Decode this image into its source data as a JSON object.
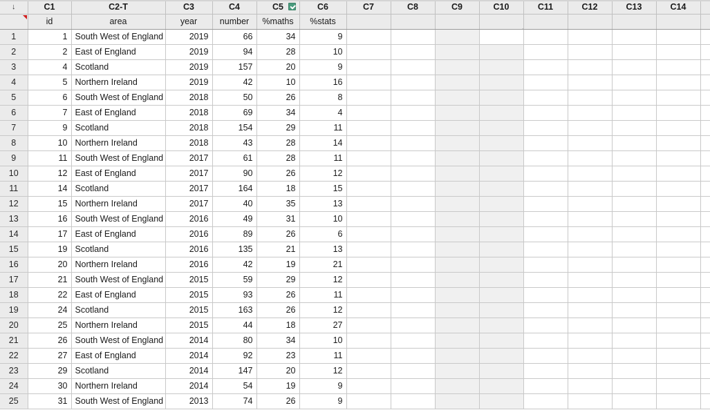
{
  "app": {
    "type": "minitab-worksheet",
    "corner_sort_icon": "down-arrow-icon",
    "row_header_marker": "red-triangle-marker"
  },
  "colors": {
    "header_bg": "#ebebeb",
    "grid_line": "#c8c8c8",
    "cell_bg": "#ffffff",
    "selection_bg": "#f0f0f0",
    "formula_badge": "#4a9c7e",
    "marker_red": "#d01f1f",
    "text": "#1a1a1a"
  },
  "columns": [
    {
      "id": "C1",
      "label": "C1",
      "name": "id",
      "type": "numeric",
      "align": "num",
      "width": 63,
      "badge": null
    },
    {
      "id": "C2",
      "label": "C2-T",
      "name": "area",
      "type": "text",
      "align": "txt",
      "width": 136,
      "badge": null
    },
    {
      "id": "C3",
      "label": "C3",
      "name": "year",
      "type": "numeric",
      "align": "num",
      "width": 68,
      "badge": null
    },
    {
      "id": "C4",
      "label": "C4",
      "name": "number",
      "type": "numeric",
      "align": "num",
      "width": 64,
      "badge": null
    },
    {
      "id": "C5",
      "label": "C5",
      "name": "%maths",
      "type": "numeric",
      "align": "num",
      "width": 62,
      "badge": "formula-badge-icon"
    },
    {
      "id": "C6",
      "label": "C6",
      "name": "%stats",
      "type": "numeric",
      "align": "num",
      "width": 68,
      "badge": null
    },
    {
      "id": "C7",
      "label": "C7",
      "name": "",
      "type": "empty",
      "align": "num",
      "width": 64,
      "badge": null
    },
    {
      "id": "C8",
      "label": "C8",
      "name": "",
      "type": "empty",
      "align": "num",
      "width": 64,
      "badge": null
    },
    {
      "id": "C9",
      "label": "C9",
      "name": "",
      "type": "empty",
      "align": "num",
      "width": 64,
      "badge": null
    },
    {
      "id": "C10",
      "label": "C10",
      "name": "",
      "type": "empty",
      "align": "num",
      "width": 64,
      "badge": null
    },
    {
      "id": "C11",
      "label": "C11",
      "name": "",
      "type": "empty",
      "align": "num",
      "width": 64,
      "badge": null
    },
    {
      "id": "C12",
      "label": "C12",
      "name": "",
      "type": "empty",
      "align": "num",
      "width": 64,
      "badge": null
    },
    {
      "id": "C13",
      "label": "C13",
      "name": "",
      "type": "empty",
      "align": "num",
      "width": 64,
      "badge": null
    },
    {
      "id": "C14",
      "label": "C14",
      "name": "",
      "type": "empty",
      "align": "num",
      "width": 64,
      "badge": null
    },
    {
      "id": "C15",
      "label": "",
      "name": "",
      "type": "empty",
      "align": "num",
      "width": 64,
      "badge": null
    }
  ],
  "selection": {
    "columns": [
      "C9",
      "C10"
    ],
    "anchor_column": "C10",
    "anchor_row": 1,
    "row_start": 1,
    "row_end": 25
  },
  "rows": [
    {
      "n": "1",
      "id": "1",
      "area": "South West of England",
      "year": "2019",
      "number": "66",
      "maths": "34",
      "stats": "9"
    },
    {
      "n": "2",
      "id": "2",
      "area": "East of England",
      "year": "2019",
      "number": "94",
      "maths": "28",
      "stats": "10"
    },
    {
      "n": "3",
      "id": "4",
      "area": "Scotland",
      "year": "2019",
      "number": "157",
      "maths": "20",
      "stats": "9"
    },
    {
      "n": "4",
      "id": "5",
      "area": "Northern Ireland",
      "year": "2019",
      "number": "42",
      "maths": "10",
      "stats": "16"
    },
    {
      "n": "5",
      "id": "6",
      "area": "South West of England",
      "year": "2018",
      "number": "50",
      "maths": "26",
      "stats": "8"
    },
    {
      "n": "6",
      "id": "7",
      "area": "East of England",
      "year": "2018",
      "number": "69",
      "maths": "34",
      "stats": "4"
    },
    {
      "n": "7",
      "id": "9",
      "area": "Scotland",
      "year": "2018",
      "number": "154",
      "maths": "29",
      "stats": "11"
    },
    {
      "n": "8",
      "id": "10",
      "area": "Northern Ireland",
      "year": "2018",
      "number": "43",
      "maths": "28",
      "stats": "14"
    },
    {
      "n": "9",
      "id": "11",
      "area": "South West of England",
      "year": "2017",
      "number": "61",
      "maths": "28",
      "stats": "11"
    },
    {
      "n": "10",
      "id": "12",
      "area": "East of England",
      "year": "2017",
      "number": "90",
      "maths": "26",
      "stats": "12"
    },
    {
      "n": "11",
      "id": "14",
      "area": "Scotland",
      "year": "2017",
      "number": "164",
      "maths": "18",
      "stats": "15"
    },
    {
      "n": "12",
      "id": "15",
      "area": "Northern Ireland",
      "year": "2017",
      "number": "40",
      "maths": "35",
      "stats": "13"
    },
    {
      "n": "13",
      "id": "16",
      "area": "South West of England",
      "year": "2016",
      "number": "49",
      "maths": "31",
      "stats": "10"
    },
    {
      "n": "14",
      "id": "17",
      "area": "East of England",
      "year": "2016",
      "number": "89",
      "maths": "26",
      "stats": "6"
    },
    {
      "n": "15",
      "id": "19",
      "area": "Scotland",
      "year": "2016",
      "number": "135",
      "maths": "21",
      "stats": "13"
    },
    {
      "n": "16",
      "id": "20",
      "area": "Northern Ireland",
      "year": "2016",
      "number": "42",
      "maths": "19",
      "stats": "21"
    },
    {
      "n": "17",
      "id": "21",
      "area": "South West of England",
      "year": "2015",
      "number": "59",
      "maths": "29",
      "stats": "12"
    },
    {
      "n": "18",
      "id": "22",
      "area": "East of England",
      "year": "2015",
      "number": "93",
      "maths": "26",
      "stats": "11"
    },
    {
      "n": "19",
      "id": "24",
      "area": "Scotland",
      "year": "2015",
      "number": "163",
      "maths": "26",
      "stats": "12"
    },
    {
      "n": "20",
      "id": "25",
      "area": "Northern Ireland",
      "year": "2015",
      "number": "44",
      "maths": "18",
      "stats": "27"
    },
    {
      "n": "21",
      "id": "26",
      "area": "South West of England",
      "year": "2014",
      "number": "80",
      "maths": "34",
      "stats": "10"
    },
    {
      "n": "22",
      "id": "27",
      "area": "East of England",
      "year": "2014",
      "number": "92",
      "maths": "23",
      "stats": "11"
    },
    {
      "n": "23",
      "id": "29",
      "area": "Scotland",
      "year": "2014",
      "number": "147",
      "maths": "20",
      "stats": "12"
    },
    {
      "n": "24",
      "id": "30",
      "area": "Northern Ireland",
      "year": "2014",
      "number": "54",
      "maths": "19",
      "stats": "9"
    },
    {
      "n": "25",
      "id": "31",
      "area": "South West of England",
      "year": "2013",
      "number": "74",
      "maths": "26",
      "stats": "9"
    }
  ]
}
